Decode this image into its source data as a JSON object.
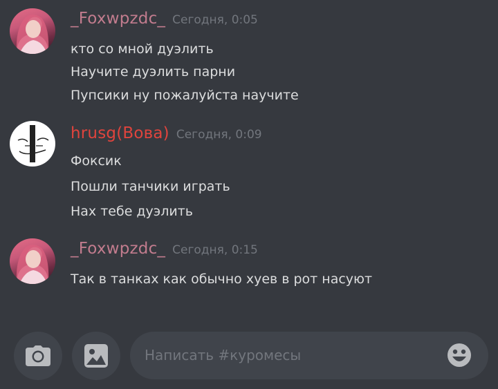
{
  "channel": {
    "placeholder": "Написать #куромесы"
  },
  "colors": {
    "background": "#36393f",
    "foxwpzdc_name": "#c27c8e",
    "hrusg_name": "#e0443d",
    "timestamp": "#72767d",
    "message_text": "#dcddde",
    "input_background": "#40444b",
    "icon": "#b9bbbe"
  },
  "messages": [
    {
      "username": "_Foxwpzdc_",
      "timestamp": "Сегодня, 0:05",
      "lines": [
        "кто со мной дуэлить",
        "Научите дуэлить парни",
        "Пупсики ну пожалуйста научите"
      ]
    },
    {
      "username": "hrusg(Вова)",
      "timestamp": "Сегодня, 0:09",
      "lines": [
        "Фоксик",
        "Пошли танчики играть",
        "Нах тебе дуэлить"
      ]
    },
    {
      "username": "_Foxwpzdc_",
      "timestamp": "Сегодня, 0:15",
      "lines": [
        "Так в танках как обычно хуев в рот насуют"
      ]
    }
  ],
  "icons": {
    "camera": "camera-icon",
    "image": "image-icon",
    "emoji": "emoji-icon"
  }
}
